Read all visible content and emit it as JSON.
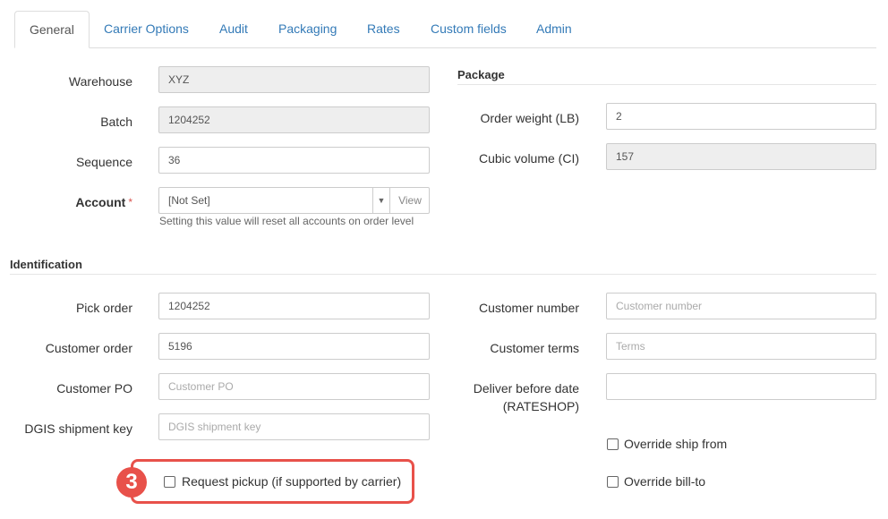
{
  "tabs": [
    {
      "label": "General",
      "active": true
    },
    {
      "label": "Carrier Options"
    },
    {
      "label": "Audit"
    },
    {
      "label": "Packaging"
    },
    {
      "label": "Rates"
    },
    {
      "label": "Custom fields"
    },
    {
      "label": "Admin"
    }
  ],
  "general": {
    "warehouse_label": "Warehouse",
    "warehouse_value": "XYZ",
    "batch_label": "Batch",
    "batch_value": "1204252",
    "sequence_label": "Sequence",
    "sequence_value": "36",
    "account_label": "Account",
    "account_required": "*",
    "account_value": "[Not Set]",
    "account_caret": "▼",
    "account_view": "View",
    "account_help": "Setting this value will reset all accounts on order level"
  },
  "package": {
    "title": "Package",
    "order_weight_label": "Order weight (LB)",
    "order_weight_value": "2",
    "cubic_volume_label": "Cubic volume (CI)",
    "cubic_volume_value": "157"
  },
  "identification": {
    "title": "Identification",
    "pick_order_label": "Pick order",
    "pick_order_value": "1204252",
    "customer_order_label": "Customer order",
    "customer_order_value": "5196",
    "customer_po_label": "Customer PO",
    "customer_po_placeholder": "Customer PO",
    "dgis_label": "DGIS shipment key",
    "dgis_placeholder": "DGIS shipment key",
    "customer_number_label": "Customer number",
    "customer_number_placeholder": "Customer number",
    "customer_terms_label": "Customer terms",
    "customer_terms_placeholder": "Terms",
    "deliver_before_label_1": "Deliver before date",
    "deliver_before_label_2": "(RATESHOP)",
    "deliver_before_value": "",
    "override_ship_from_label": "Override ship from",
    "override_bill_to_label": "Override bill-to",
    "request_pickup_label": "Request pickup (if supported by carrier)"
  },
  "annotation": {
    "step_number": "3",
    "color": "#e8514a"
  },
  "colors": {
    "link": "#337ab7",
    "readonly_bg": "#eeeeee",
    "required": "#d9534f"
  }
}
